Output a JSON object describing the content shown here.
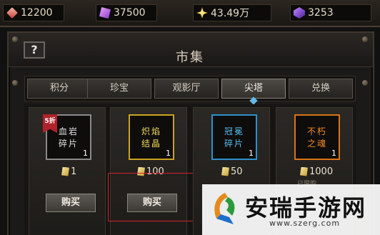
{
  "currencies": [
    {
      "icon": "blood-crystal-icon",
      "value": "12200"
    },
    {
      "icon": "rune-icon",
      "value": "37500"
    },
    {
      "icon": "gold-star-icon",
      "value": "43.49万"
    },
    {
      "icon": "purple-gem-icon",
      "value": "3253"
    }
  ],
  "header": {
    "help": "?",
    "title": "市集"
  },
  "tabs": [
    {
      "label": "积分",
      "active": false
    },
    {
      "label": "珍宝",
      "active": false
    },
    {
      "label": "观影厅",
      "active": false
    },
    {
      "label": "尖塔",
      "active": true
    },
    {
      "label": "兑换",
      "active": false
    }
  ],
  "items": [
    {
      "name_line1": "血岩",
      "name_line2": "碎片",
      "quantity": "1",
      "price": "1",
      "badge": "5折",
      "rarity_color": "#8a8a8a",
      "buy_label": "购买"
    },
    {
      "name_line1": "炽焰",
      "name_line2": "结晶",
      "quantity": "1",
      "price": "100",
      "rarity_color": "#c9a21f",
      "buy_label": "购买"
    },
    {
      "name_line1": "冠冕",
      "name_line2": "碎片",
      "quantity": "1",
      "price": "50",
      "rarity_color": "#2f8fc8"
    },
    {
      "name_line1": "不朽",
      "name_line2": "之魂",
      "quantity": "1",
      "price": "1000",
      "limit_text": "已限购",
      "rarity_color": "#d97416"
    }
  ],
  "watermark": {
    "brand": "安瑞手游网",
    "url": "www.szerg.com"
  }
}
